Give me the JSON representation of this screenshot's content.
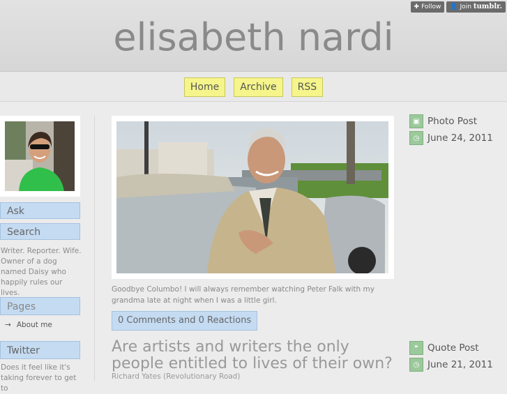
{
  "header": {
    "title": "elisabeth nardi"
  },
  "tumblr": {
    "follow": "Follow",
    "join_prefix": "Join",
    "join_brand": "tumblr."
  },
  "nav": {
    "items": [
      {
        "label": "Home"
      },
      {
        "label": "Archive"
      },
      {
        "label": "RSS"
      }
    ]
  },
  "sidebar": {
    "ask": "Ask",
    "search": "Search",
    "bio": "Writer. Reporter. Wife. Owner of a dog named Daisy who happily rules our lives.",
    "pages_heading": "Pages",
    "pages_link": "About me",
    "pages_arrow": "→",
    "twitter_heading": "Twitter",
    "twitter_text": "Does it feel like it's taking forever to get to"
  },
  "posts": [
    {
      "type": "Photo Post",
      "date": "June 24, 2011",
      "caption": "Goodbye Columbo! I will always remember watching Peter Falk with my grandma late at night when I was a little girl.",
      "comments": "0 Comments and 0 Reactions"
    },
    {
      "type": "Quote Post",
      "date": "June 21, 2011",
      "quote": "Are artists and writers the only people entitled to lives of their own?",
      "source": "Richard Yates (Revolutionary Road)"
    }
  ],
  "colors": {
    "nav_bg": "#f5f58c",
    "sidebar_button_bg": "#c4dbf2",
    "meta_icon": "#9bc99b"
  }
}
